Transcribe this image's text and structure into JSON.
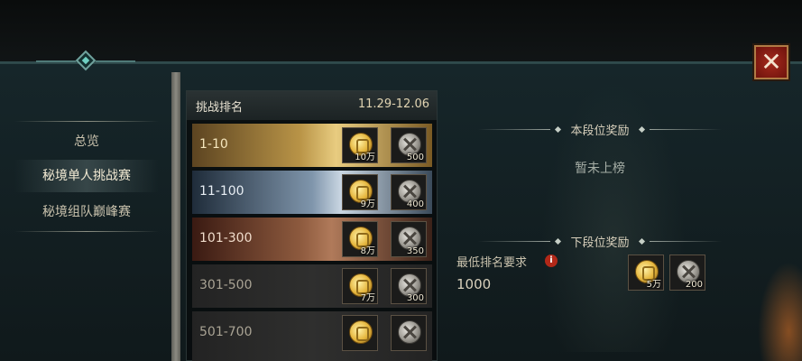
{
  "sidebar": {
    "items": [
      {
        "label": "总览",
        "active": false
      },
      {
        "label": "秘境单人挑战赛",
        "active": true
      },
      {
        "label": "秘境组队巅峰赛",
        "active": false
      }
    ]
  },
  "rank_panel": {
    "title": "挑战排名",
    "date_range": "11.29-12.06",
    "rows": [
      {
        "label": "1-10",
        "gold_qty": "10万",
        "silver_qty": "500",
        "tier_color": "#c9a24d"
      },
      {
        "label": "11-100",
        "gold_qty": "9万",
        "silver_qty": "400",
        "tier_color": "#7e93a6"
      },
      {
        "label": "101-300",
        "gold_qty": "8万",
        "silver_qty": "350",
        "tier_color": "#8d5a3e"
      },
      {
        "label": "301-500",
        "gold_qty": "7万",
        "silver_qty": "300",
        "tier_color": "#2c2c2b"
      },
      {
        "label": "501-700",
        "gold_qty": "",
        "silver_qty": "",
        "tier_color": "#2c2c2b"
      }
    ]
  },
  "reward_panel": {
    "current_title": "本段位奖励",
    "current_status": "暂未上榜",
    "next_title": "下段位奖励",
    "min_rank_label": "最低排名要求",
    "min_rank_value": "1000",
    "next_gold_qty": "5万",
    "next_silver_qty": "200"
  },
  "icons": {
    "close": "close-icon",
    "info": "info-icon",
    "gold": "gold-coin-icon",
    "silver": "silver-coin-icon"
  },
  "close_symbol": "✕",
  "info_symbol": "i"
}
